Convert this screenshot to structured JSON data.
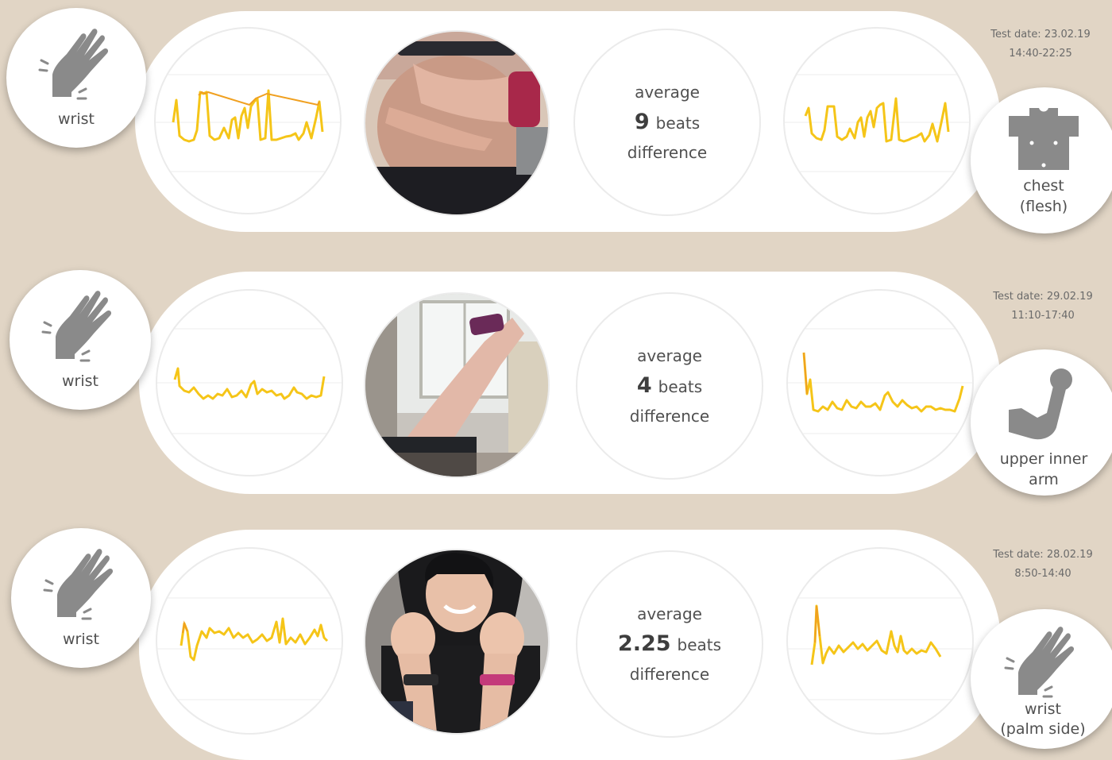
{
  "rows": [
    {
      "test_date": "Test date: 23.02.19",
      "test_time": "14:40-22:25",
      "left_sensor": {
        "label": "wrist",
        "icon": "hand-icon"
      },
      "right_sensor": {
        "label_line1": "chest",
        "label_line2": "(flesh)",
        "icon": "torso-icon"
      },
      "stat": {
        "prefix": "average",
        "value": "9",
        "unit": "beats",
        "suffix": "difference"
      },
      "photo": "photo-chest-strap"
    },
    {
      "test_date": "Test date: 29.02.19",
      "test_time": "11:10-17:40",
      "left_sensor": {
        "label": "wrist",
        "icon": "hand-icon"
      },
      "right_sensor": {
        "label_line1": "upper inner",
        "label_line2": "arm",
        "icon": "arm-icon"
      },
      "stat": {
        "prefix": "average",
        "value": "4",
        "unit": "beats",
        "suffix": "difference"
      },
      "photo": "photo-upper-arm"
    },
    {
      "test_date": "Test date: 28.02.19",
      "test_time": "8:50-14:40",
      "left_sensor": {
        "label": "wrist",
        "icon": "hand-icon"
      },
      "right_sensor": {
        "label_line1": "wrist",
        "label_line2": "(palm side)",
        "icon": "hand-icon"
      },
      "stat": {
        "prefix": "average",
        "value": "2.25",
        "unit": "beats",
        "suffix": "difference"
      },
      "photo": "photo-two-wrists"
    }
  ],
  "colors": {
    "background": "#e1d5c5",
    "line": "#f5c518",
    "line_peak": "#f0a020",
    "icon": "#8a8a8a"
  }
}
